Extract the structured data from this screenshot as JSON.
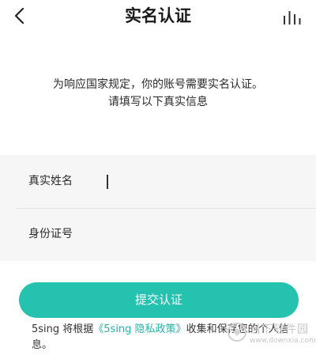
{
  "header": {
    "title": "实名认证"
  },
  "notice": {
    "line1": "为响应国家规定，你的账号需要实名认证。",
    "line2": "请填写以下真实信息"
  },
  "form": {
    "name_label": "真实姓名",
    "name_value": "",
    "id_label": "身份证号",
    "id_value": ""
  },
  "submit": {
    "label": "提交认证"
  },
  "privacy": {
    "prefix": "5sing 将根据",
    "link": "《5sing 隐私政策》",
    "suffix": "收集和保存您的个人信息。"
  },
  "watermark": {
    "text": "当下软件园",
    "url": "www.downxia.com"
  },
  "colors": {
    "accent": "#25c2b0",
    "link": "#25b3a6",
    "form_bg": "#f6f6f6"
  },
  "icons": {
    "back": "chevron-left-icon",
    "stats": "bar-chart-icon"
  }
}
